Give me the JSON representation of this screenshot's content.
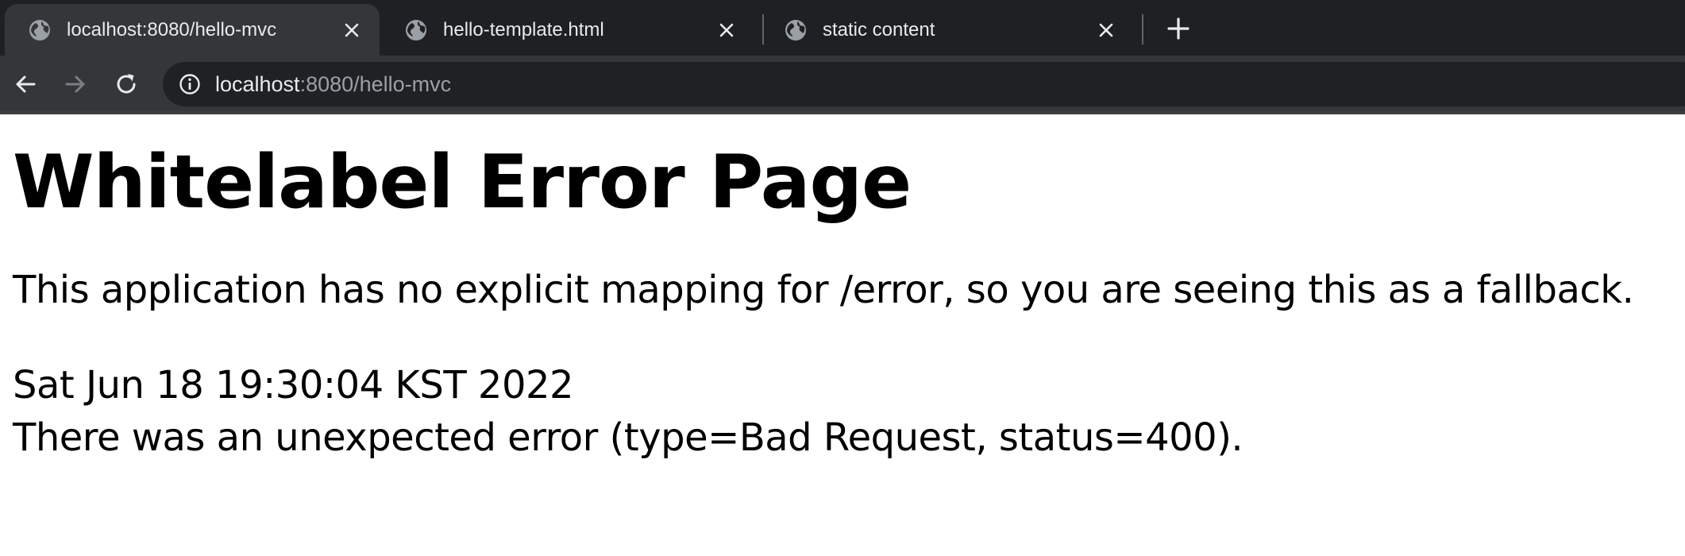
{
  "browser": {
    "tabs": [
      {
        "title": "localhost:8080/hello-mvc",
        "active": true,
        "icon": "globe-icon"
      },
      {
        "title": "hello-template.html",
        "active": false,
        "icon": "globe-icon"
      },
      {
        "title": "static content",
        "active": false,
        "icon": "globe-icon"
      }
    ],
    "address_bar": {
      "host": "localhost",
      "rest": ":8080/hello-mvc"
    }
  },
  "page": {
    "title": "Whitelabel Error Page",
    "message": "This application has no explicit mapping for /error, so you are seeing this as a fallback.",
    "timestamp": "Sat Jun 18 19:30:04 KST 2022",
    "error": "There was an unexpected error (type=Bad Request, status=400)."
  },
  "colors": {
    "chrome_dark": "#1f2023",
    "chrome_active": "#35363a",
    "omnibox": "#202124",
    "text_light": "#e8eaed",
    "text_muted": "#9aa0a6"
  }
}
